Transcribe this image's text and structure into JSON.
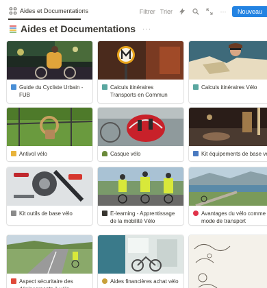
{
  "view": {
    "tab_label": "Aides et Documentations",
    "add_symbol": "+"
  },
  "toolbar": {
    "filter_label": "Filtrer",
    "sort_label": "Trier",
    "more_symbol": "···",
    "new_label": "Nouveau"
  },
  "page": {
    "title": "Aides et Documentations",
    "more_symbol": "···"
  },
  "colors": {
    "accent": "#2383e2",
    "text": "#37352f",
    "muted": "#9b9a97"
  },
  "cards": [
    {
      "title": "Guide du Cycliste Urbain - FUB",
      "icon": "folder-icon"
    },
    {
      "title": "Calculs itinéraires Transports en Commun",
      "icon": "map-icon"
    },
    {
      "title": "Calculs itinéraires Vélo",
      "icon": "map-icon"
    },
    {
      "title": "Antivol vélo",
      "icon": "lock-icon"
    },
    {
      "title": "Casque vélo",
      "icon": "helmet-icon"
    },
    {
      "title": "Kit équipements de base vél",
      "icon": "jacket-icon"
    },
    {
      "title": "Kit outils de base vélo",
      "icon": "wrench-icon"
    },
    {
      "title": "E-learning - Apprentissage de la mobilité Vélo",
      "icon": "mortarboard-icon"
    },
    {
      "title": "Avantages du vélo comme mode de transport",
      "icon": "heart-icon"
    },
    {
      "title": "Aspect sécuritaire des déplacements à vélo",
      "icon": "warning-icon"
    },
    {
      "title": "Aides financières achat vélo",
      "icon": "money-bag-icon"
    },
    {
      "title": "",
      "icon": ""
    }
  ]
}
